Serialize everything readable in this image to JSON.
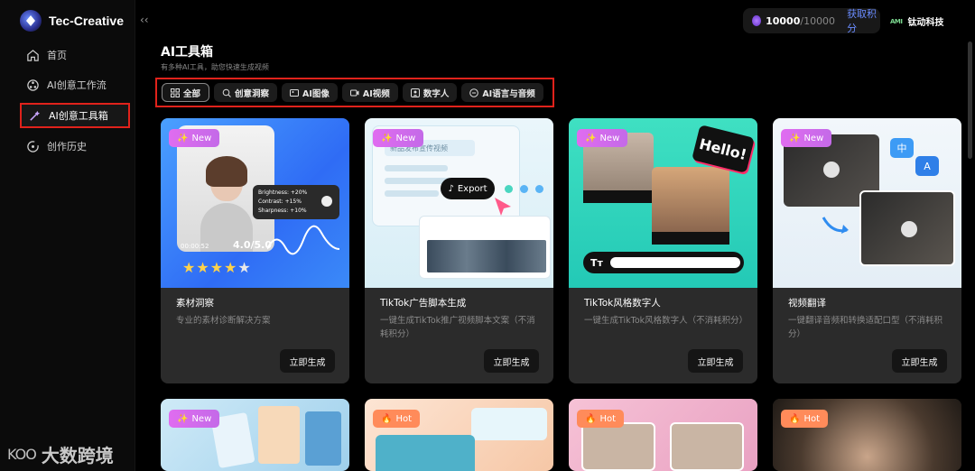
{
  "app": {
    "title": "Tec-Creative",
    "collapse_icon": "‹‹"
  },
  "sidebar": {
    "items": [
      {
        "label": "首页",
        "icon": "home-icon"
      },
      {
        "label": "AI创意工作流",
        "icon": "workflow-icon"
      },
      {
        "label": "AI创意工具箱",
        "icon": "magic-wand-icon",
        "active": true
      },
      {
        "label": "创作历史",
        "icon": "history-icon"
      }
    ]
  },
  "topbar": {
    "credits_current": "10000",
    "credits_total": "/10000",
    "get_credits": "获取积分",
    "company": "钛动科技",
    "company_logo": "AMI"
  },
  "page": {
    "title": "AI工具箱",
    "subtitle": "有多种AI工具，助您快速生成视频"
  },
  "tabs": [
    {
      "label": "全部",
      "icon": "grid-icon",
      "active": true
    },
    {
      "label": "创意洞察",
      "icon": "insight-icon"
    },
    {
      "label": "AI图像",
      "icon": "image-icon"
    },
    {
      "label": "AI视频",
      "icon": "video-icon"
    },
    {
      "label": "数字人",
      "icon": "person-icon"
    },
    {
      "label": "AI语言与音频",
      "icon": "audio-icon"
    }
  ],
  "cards": [
    {
      "badge": "New",
      "badge_icon": "sparkle-icon",
      "title": "素材洞察",
      "desc": "专业的素材诊断解决方案",
      "button": "立即生成",
      "art": {
        "time": "00:00:52",
        "score": "4.0/5.0",
        "brightness": "Brightness: +20%",
        "contrast": "Contrast: +15%",
        "sharpness": "Sharpness: +10%"
      }
    },
    {
      "badge": "New",
      "badge_icon": "sparkle-icon",
      "title": "TikTok广告脚本生成",
      "desc": "一键生成TikTok推广视频脚本文案（不消耗积分）",
      "button": "立即生成",
      "art": {
        "banner": "新品发布宣传视频",
        "export": "Export"
      }
    },
    {
      "badge": "New",
      "badge_icon": "sparkle-icon",
      "title": "TikTok风格数字人",
      "desc": "一键生成TikTok风格数字人（不消耗积分）",
      "button": "立即生成",
      "art": {
        "hello": "Hello!",
        "tt": "Tт"
      }
    },
    {
      "badge": "New",
      "badge_icon": "sparkle-icon",
      "title": "视频翻译",
      "desc": "一键翻译音频和转换适配口型（不消耗积分）",
      "button": "立即生成",
      "art": {
        "zh": "中",
        "en": "A"
      }
    }
  ],
  "bottom_cards": [
    {
      "badge": "New",
      "badge_icon": "sparkle-icon"
    },
    {
      "badge": "Hot",
      "badge_icon": "fire-icon"
    },
    {
      "badge": "Hot",
      "badge_icon": "fire-icon"
    },
    {
      "badge": "Hot",
      "badge_icon": "fire-icon"
    }
  ],
  "watermark": {
    "logo": "KOO",
    "text": "大数跨境"
  },
  "colors": {
    "accent": "#6a8cff",
    "highlight_border": "#e0221b",
    "badge_new": "#d66cf0",
    "badge_hot": "#ff8b5a",
    "card_bg": "#2b2b2b"
  }
}
